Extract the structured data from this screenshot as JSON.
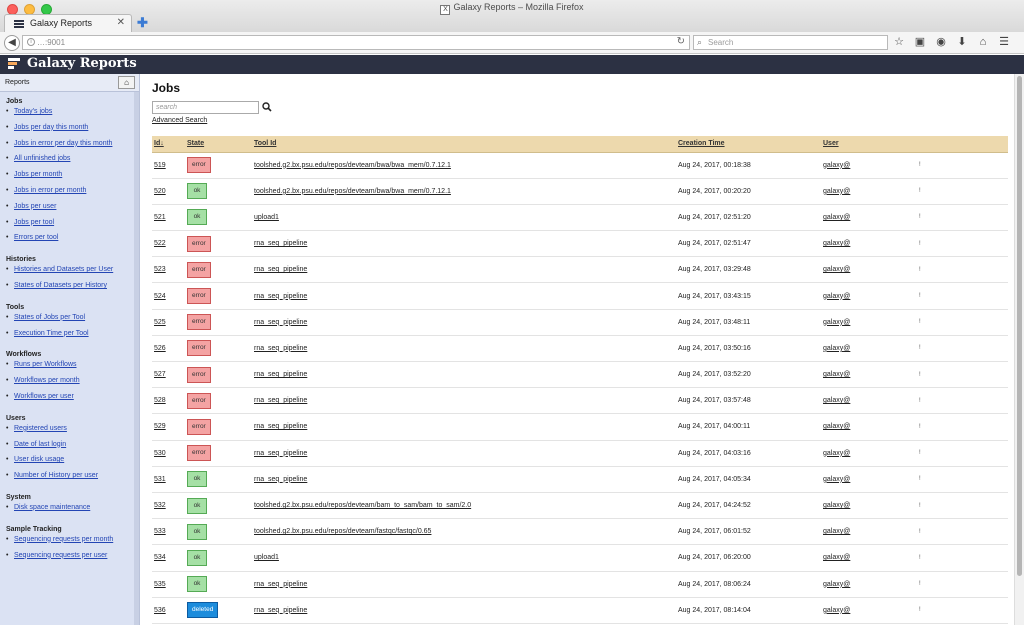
{
  "window": {
    "title": "Galaxy Reports – Mozilla Firefox"
  },
  "browser": {
    "tab_label": "Galaxy Reports",
    "url": "…:9001",
    "search_placeholder": "Search"
  },
  "masthead": {
    "brand": "Galaxy Reports"
  },
  "sidebar": {
    "header": "Reports",
    "sections": [
      {
        "title": "Jobs",
        "items": [
          "Today's jobs",
          "Jobs per day this month",
          "Jobs in error per day this month",
          "All unfinished jobs",
          "Jobs per month",
          "Jobs in error per month",
          "Jobs per user",
          "Jobs per tool",
          "Errors per tool"
        ]
      },
      {
        "title": "Histories",
        "items": [
          "Histories and Datasets per User",
          "States of Datasets per History"
        ]
      },
      {
        "title": "Tools",
        "items": [
          "States of Jobs per Tool",
          "Execution Time per Tool"
        ]
      },
      {
        "title": "Workflows",
        "items": [
          "Runs per Workflows",
          "Workflows per month",
          "Workflows per user"
        ]
      },
      {
        "title": "Users",
        "items": [
          "Registered users",
          "Date of last login",
          "User disk usage",
          "Number of History per user"
        ]
      },
      {
        "title": "System",
        "items": [
          "Disk space maintenance"
        ]
      },
      {
        "title": "Sample Tracking",
        "items": [
          "Sequencing requests per month",
          "Sequencing requests per user"
        ]
      }
    ]
  },
  "main": {
    "title": "Jobs",
    "search_placeholder": "search",
    "advanced_search": "Advanced Search",
    "columns": [
      "Id↓",
      "State",
      "Tool Id",
      "Creation Time",
      "User"
    ],
    "rows": [
      {
        "id": "519",
        "state": "error",
        "tool": "toolshed.g2.bx.psu.edu/repos/devteam/bwa/bwa_mem/0.7.12.1",
        "time": "Aug 24, 2017, 00:18:38",
        "user": "galaxy@",
        "extra": "!"
      },
      {
        "id": "520",
        "state": "ok",
        "tool": "toolshed.g2.bx.psu.edu/repos/devteam/bwa/bwa_mem/0.7.12.1",
        "time": "Aug 24, 2017, 00:20:20",
        "user": "galaxy@",
        "extra": "!"
      },
      {
        "id": "521",
        "state": "ok",
        "tool": "upload1",
        "time": "Aug 24, 2017, 02:51:20",
        "user": "galaxy@",
        "extra": "!"
      },
      {
        "id": "522",
        "state": "error",
        "tool": "rna_seq_pipeline",
        "time": "Aug 24, 2017, 02:51:47",
        "user": "galaxy@",
        "extra": "!"
      },
      {
        "id": "523",
        "state": "error",
        "tool": "rna_seq_pipeline",
        "time": "Aug 24, 2017, 03:29:48",
        "user": "galaxy@",
        "extra": "!"
      },
      {
        "id": "524",
        "state": "error",
        "tool": "rna_seq_pipeline",
        "time": "Aug 24, 2017, 03:43:15",
        "user": "galaxy@",
        "extra": "!"
      },
      {
        "id": "525",
        "state": "error",
        "tool": "rna_seq_pipeline",
        "time": "Aug 24, 2017, 03:48:11",
        "user": "galaxy@",
        "extra": "!"
      },
      {
        "id": "526",
        "state": "error",
        "tool": "rna_seq_pipeline",
        "time": "Aug 24, 2017, 03:50:16",
        "user": "galaxy@",
        "extra": "!"
      },
      {
        "id": "527",
        "state": "error",
        "tool": "rna_seq_pipeline",
        "time": "Aug 24, 2017, 03:52:20",
        "user": "galaxy@",
        "extra": "!"
      },
      {
        "id": "528",
        "state": "error",
        "tool": "rna_seq_pipeline",
        "time": "Aug 24, 2017, 03:57:48",
        "user": "galaxy@",
        "extra": "!"
      },
      {
        "id": "529",
        "state": "error",
        "tool": "rna_seq_pipeline",
        "time": "Aug 24, 2017, 04:00:11",
        "user": "galaxy@",
        "extra": "!"
      },
      {
        "id": "530",
        "state": "error",
        "tool": "rna_seq_pipeline",
        "time": "Aug 24, 2017, 04:03:16",
        "user": "galaxy@",
        "extra": "!"
      },
      {
        "id": "531",
        "state": "ok",
        "tool": "rna_seq_pipeline",
        "time": "Aug 24, 2017, 04:05:34",
        "user": "galaxy@",
        "extra": "!"
      },
      {
        "id": "532",
        "state": "ok",
        "tool": "toolshed.g2.bx.psu.edu/repos/devteam/bam_to_sam/bam_to_sam/2.0",
        "time": "Aug 24, 2017, 04:24:52",
        "user": "galaxy@",
        "extra": "!"
      },
      {
        "id": "533",
        "state": "ok",
        "tool": "toolshed.g2.bx.psu.edu/repos/devteam/fastqc/fastqc/0.65",
        "time": "Aug 24, 2017, 06:01:52",
        "user": "galaxy@",
        "extra": "!"
      },
      {
        "id": "534",
        "state": "ok",
        "tool": "upload1",
        "time": "Aug 24, 2017, 06:20:00",
        "user": "galaxy@",
        "extra": "!"
      },
      {
        "id": "535",
        "state": "ok",
        "tool": "rna_seq_pipeline",
        "time": "Aug 24, 2017, 08:06:24",
        "user": "galaxy@",
        "extra": "!"
      },
      {
        "id": "536",
        "state": "deleted",
        "tool": "rna_seq_pipeline",
        "time": "Aug 24, 2017, 08:14:04",
        "user": "galaxy@",
        "extra": "!"
      }
    ]
  }
}
